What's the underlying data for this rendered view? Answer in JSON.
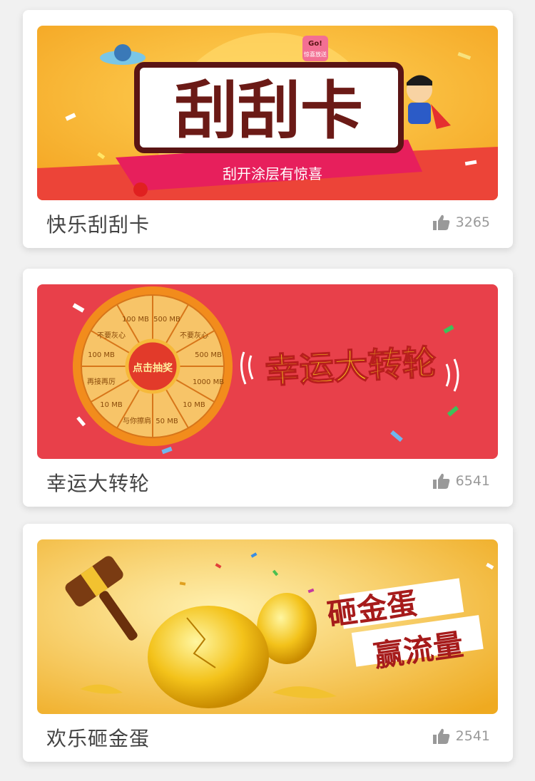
{
  "cards": [
    {
      "title": "快乐刮刮卡",
      "likes": "3265",
      "banner": {
        "headline": "刮刮卡",
        "subtitle": "刮开涂层有惊喜",
        "badge_top": "Go!",
        "badge_bottom": "惊喜放送",
        "bg_color": "#f5b32c",
        "ribbon_color": "#e83a4a"
      }
    },
    {
      "title": "幸运大转轮",
      "likes": "6541",
      "banner": {
        "headline": "幸运大转轮",
        "center_button": "点击抽奖",
        "wheel_slots": [
          "100 MB",
          "500 MB",
          "不要灰心",
          "500 MB",
          "1000 MB",
          "10 MB",
          "50 MB",
          "与你擦肩",
          "10 MB",
          "再接再厉",
          "100 MB",
          "不要灰心"
        ],
        "bg_color": "#e8404a"
      }
    },
    {
      "title": "欢乐砸金蛋",
      "likes": "2541",
      "banner": {
        "headline_line1": "砸金蛋",
        "headline_line2": "赢流量",
        "bg_color": "#f2b428"
      }
    }
  ],
  "icons": {
    "like": "thumbs-up-icon",
    "hammer": "hammer-icon",
    "egg": "golden-egg-icon",
    "wheel": "prize-wheel-icon"
  }
}
